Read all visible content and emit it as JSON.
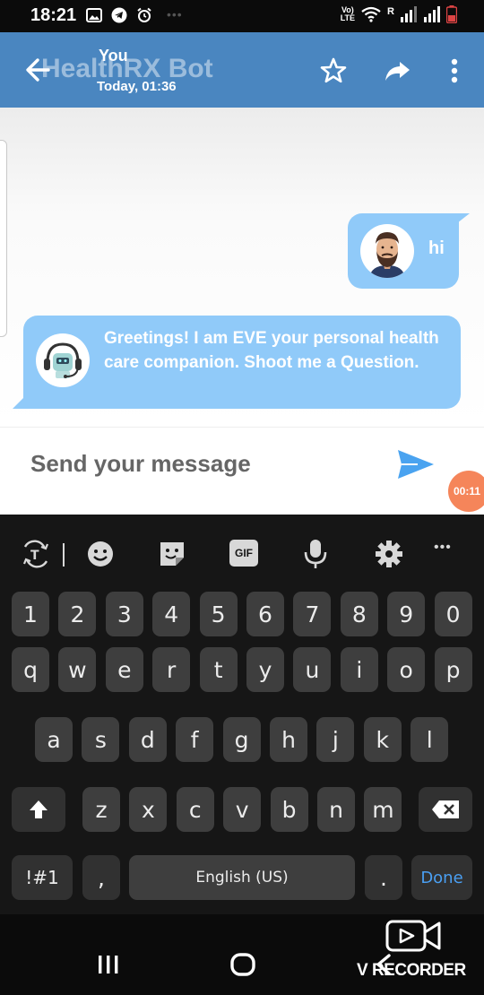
{
  "status_bar": {
    "time": "18:21",
    "volte_line1": "Vo)",
    "volte_line2": "LTE",
    "roaming": "R",
    "icons": [
      "image-icon",
      "telegram-icon",
      "alarm-icon",
      "wifi-icon",
      "signal-icon",
      "battery-icon"
    ]
  },
  "app_bar": {
    "title": "HealthRX Bot",
    "sender": "You",
    "timestamp": "Today, 01:36",
    "actions": [
      "star-icon",
      "share-icon",
      "more-icon"
    ]
  },
  "chat": {
    "messages": [
      {
        "from": "user",
        "text": "hi"
      },
      {
        "from": "bot",
        "text": "Greetings! I am EVE your personal health care companion. Shoot me a Question."
      }
    ],
    "bubble_color": "#90caf9"
  },
  "composer": {
    "placeholder": "Send your message",
    "send_color": "#4aa3f0"
  },
  "recorder_badge": "00:11",
  "keyboard": {
    "toolbar": {
      "gif_label": "GIF",
      "more": "•••"
    },
    "row_numbers": [
      "1",
      "2",
      "3",
      "4",
      "5",
      "6",
      "7",
      "8",
      "9",
      "0"
    ],
    "row_1": [
      "q",
      "w",
      "e",
      "r",
      "t",
      "y",
      "u",
      "i",
      "o",
      "p"
    ],
    "row_2": [
      "a",
      "s",
      "d",
      "f",
      "g",
      "h",
      "j",
      "k",
      "l"
    ],
    "row_3": [
      "z",
      "x",
      "c",
      "v",
      "b",
      "n",
      "m"
    ],
    "symbols_key": "!#1",
    "comma_key": ",",
    "space_key": "English (US)",
    "period_key": ".",
    "done_key": "Done",
    "accent_color": "#4a9ff2"
  },
  "watermark": "V RECORDER"
}
